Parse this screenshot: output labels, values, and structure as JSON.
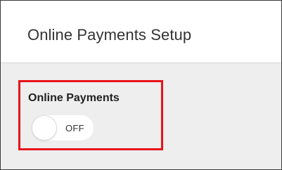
{
  "header": {
    "title": "Online Payments Setup"
  },
  "online_payments": {
    "label": "Online Payments",
    "toggle_state_label": "OFF",
    "enabled": false
  },
  "colors": {
    "highlight_border": "#e8141b",
    "content_background": "#eeeeee",
    "header_background": "#ffffff"
  }
}
